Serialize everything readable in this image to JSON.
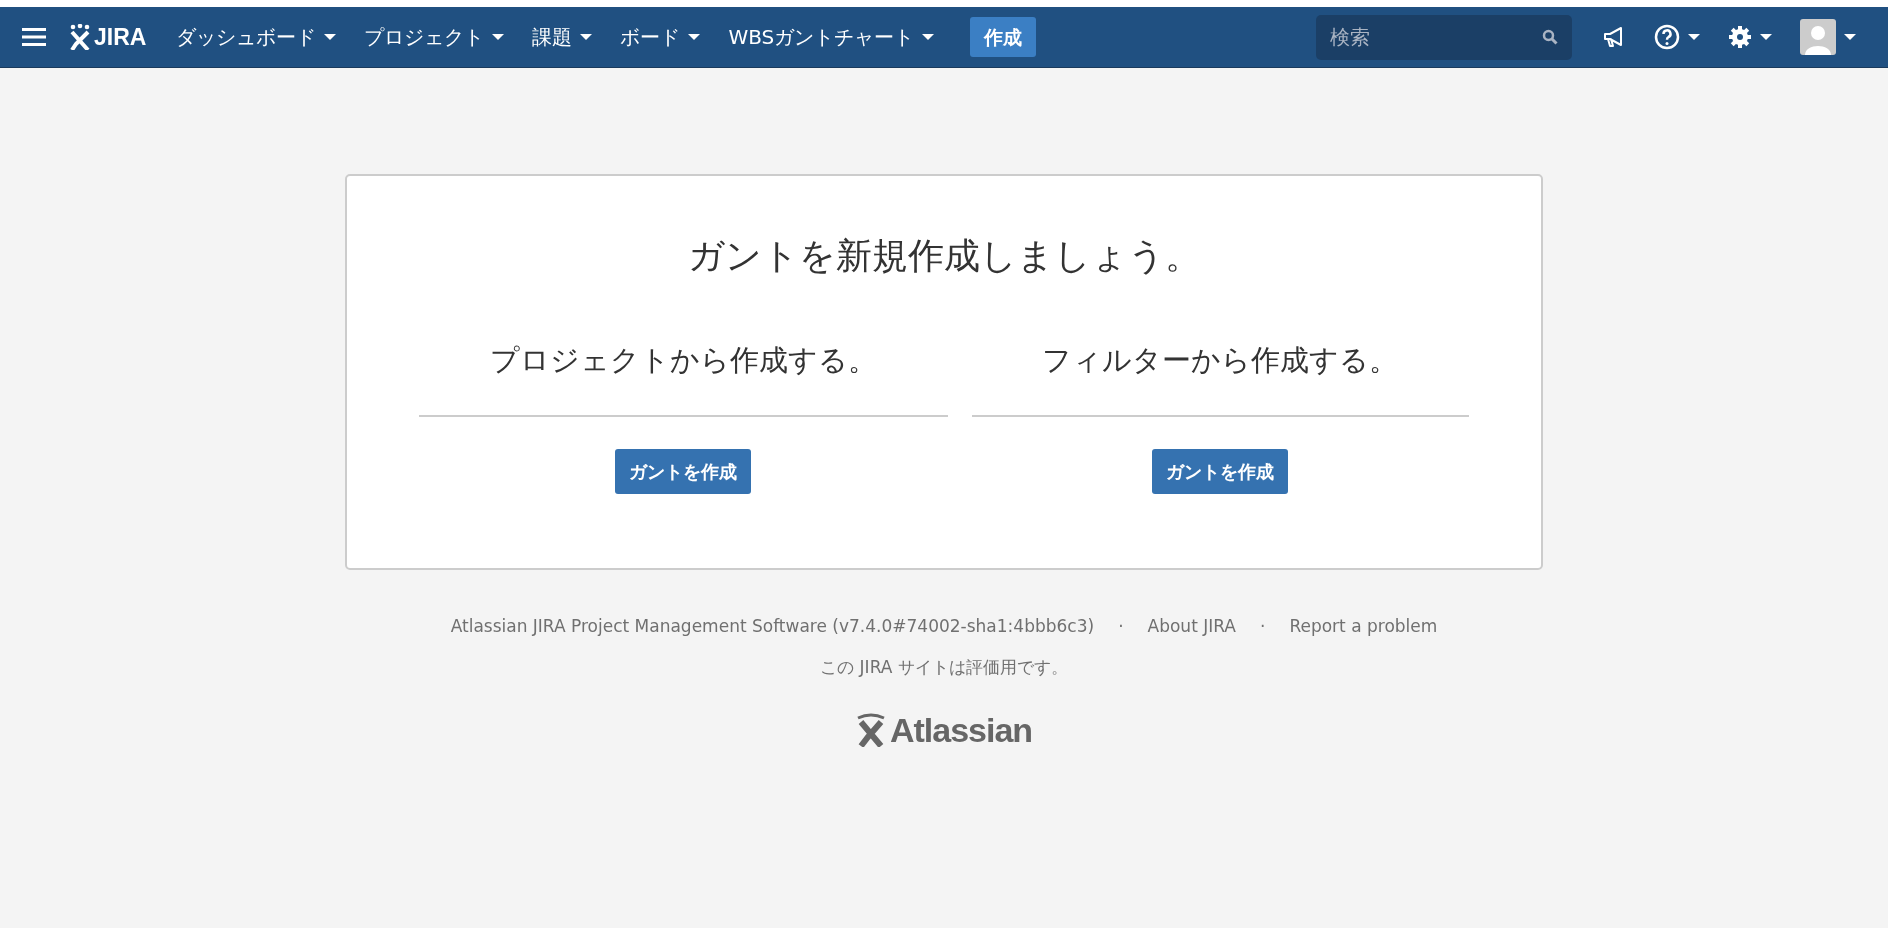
{
  "navbar": {
    "logo": "JIRA",
    "menus": [
      {
        "label": "ダッシュボード"
      },
      {
        "label": "プロジェクト"
      },
      {
        "label": "課題"
      },
      {
        "label": "ボード"
      },
      {
        "label": "WBSガントチャート"
      }
    ],
    "create_button": "作成",
    "search": {
      "placeholder": "検索"
    }
  },
  "panel": {
    "title": "ガントを新規作成しましょう。",
    "options": [
      {
        "heading": "プロジェクトから作成する。",
        "button": "ガントを作成"
      },
      {
        "heading": "フィルターから作成する。",
        "button": "ガントを作成"
      }
    ]
  },
  "footer": {
    "version": "Atlassian JIRA Project Management Software (v7.4.0#74002-sha1:4bbb6c3)",
    "links": [
      "About JIRA",
      "Report a problem"
    ],
    "separator": "·",
    "note": "この JIRA サイトは評価用です。",
    "logo": "Atlassian"
  }
}
